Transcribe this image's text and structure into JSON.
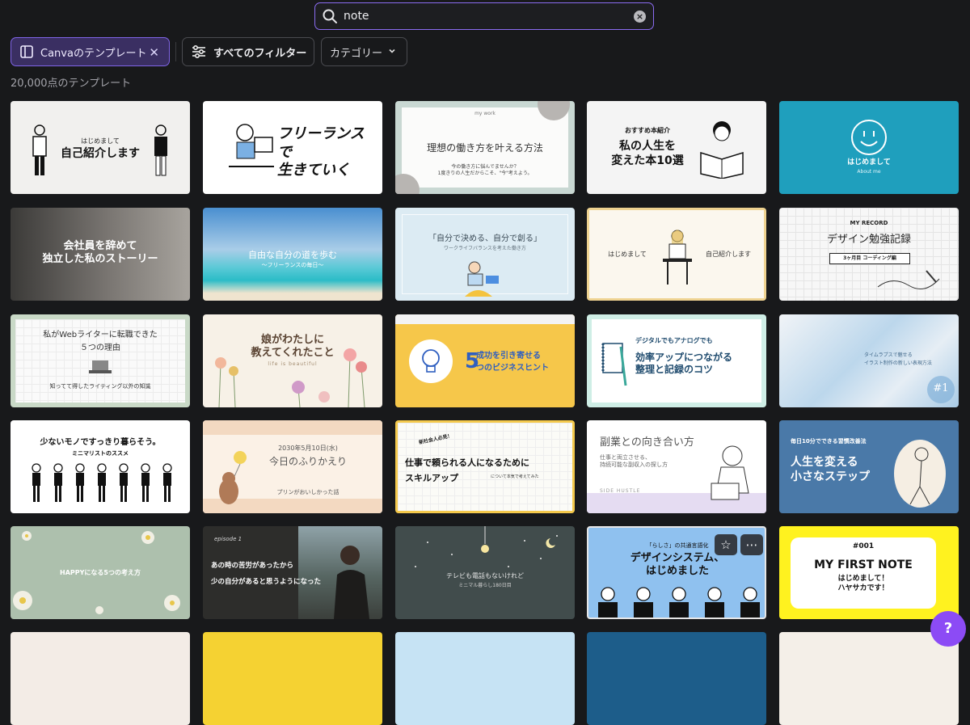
{
  "search": {
    "query": "note"
  },
  "filters": {
    "canva_templates": "Canvaのテンプレート",
    "all_filters": "すべてのフィルター",
    "category": "カテゴリー"
  },
  "result_count": "20,000点のテンプレート",
  "cards": [
    {
      "title": "自己紹介します",
      "sub": "はじめまして"
    },
    {
      "title": "フリーランスで\n生きていく",
      "sub": ""
    },
    {
      "title": "理想の働き方を叶える方法",
      "sub": "今の働き方に悩んでませんか？\n1度きりの人生だからこそ、\"今\"考えよう。",
      "tag": "my work"
    },
    {
      "title": "私の人生を\n変えた本10選",
      "sub": "おすすめ本紹介"
    },
    {
      "title": "はじめまして",
      "sub": "About me"
    },
    {
      "title": "会社員を辞めて\n独立した私のストーリー",
      "sub": ""
    },
    {
      "title": "自由な自分の道を歩む",
      "sub": "〜フリーランスの毎日〜"
    },
    {
      "title": "「自分で決める、自分で創る」",
      "sub": "ワークライフバランスを考えた働き方"
    },
    {
      "title": "はじめまして",
      "sub": "自己紹介します"
    },
    {
      "title": "デザイン勉強記録",
      "sub": "3ヶ月目 コーディング編",
      "tag": "MY RECORD"
    },
    {
      "title": "私がWebライターに転職できた\n５つの理由",
      "sub": "知ってて得したライティング以外の知識"
    },
    {
      "title": "娘がわたしに\n教えてくれたこと",
      "sub": "life is beautiful"
    },
    {
      "title": "成功を引き寄せる\nつのビジネスヒント",
      "sub": "5"
    },
    {
      "title": "効率アップにつながる\n整理と記録のコツ",
      "sub": "デジタルでもアナログでも"
    },
    {
      "title": "イラスト制作の新しい表現方法",
      "sub": "タイムラプスで魅せる",
      "tag": "#1"
    },
    {
      "title": "少ないモノですっきり暮らそう。",
      "sub": "ミニマリストのススメ"
    },
    {
      "title": "今日のふりかえり",
      "sub": "2030年5月10日(水)",
      "extra": "プリンがおいしかった話"
    },
    {
      "title": "仕事で頼られる人になるために\nスキルアップ",
      "sub": "新社会人必見！",
      "extra": "について本気で考えてみた"
    },
    {
      "title": "副業との向き合い方",
      "sub": "仕事と両立させる、\n持続可能な副収入の探し方",
      "extra": "SIDE HUSTLE"
    },
    {
      "title": "人生を変える\n小さなステップ",
      "sub": "毎日10分でできる習慣改善法"
    },
    {
      "title": "HAPPYになる5つの考え方",
      "sub": ""
    },
    {
      "title": "あの時の苦労があったから\n少の自分があると思うようになった",
      "sub": "episode 1"
    },
    {
      "title": "テレビも電話もないけれど",
      "sub": "ミニマル暮らし180日目"
    },
    {
      "title": "デザインシステム、\nはじめました",
      "sub": "「らしさ」の共通言語化"
    },
    {
      "title": "MY FIRST NOTE",
      "sub": "はじめまして！\nハヤサカです！",
      "tag": "#001"
    }
  ],
  "help": "?",
  "colors": {
    "accent": "#8b6cf2",
    "background": "#18191b"
  }
}
